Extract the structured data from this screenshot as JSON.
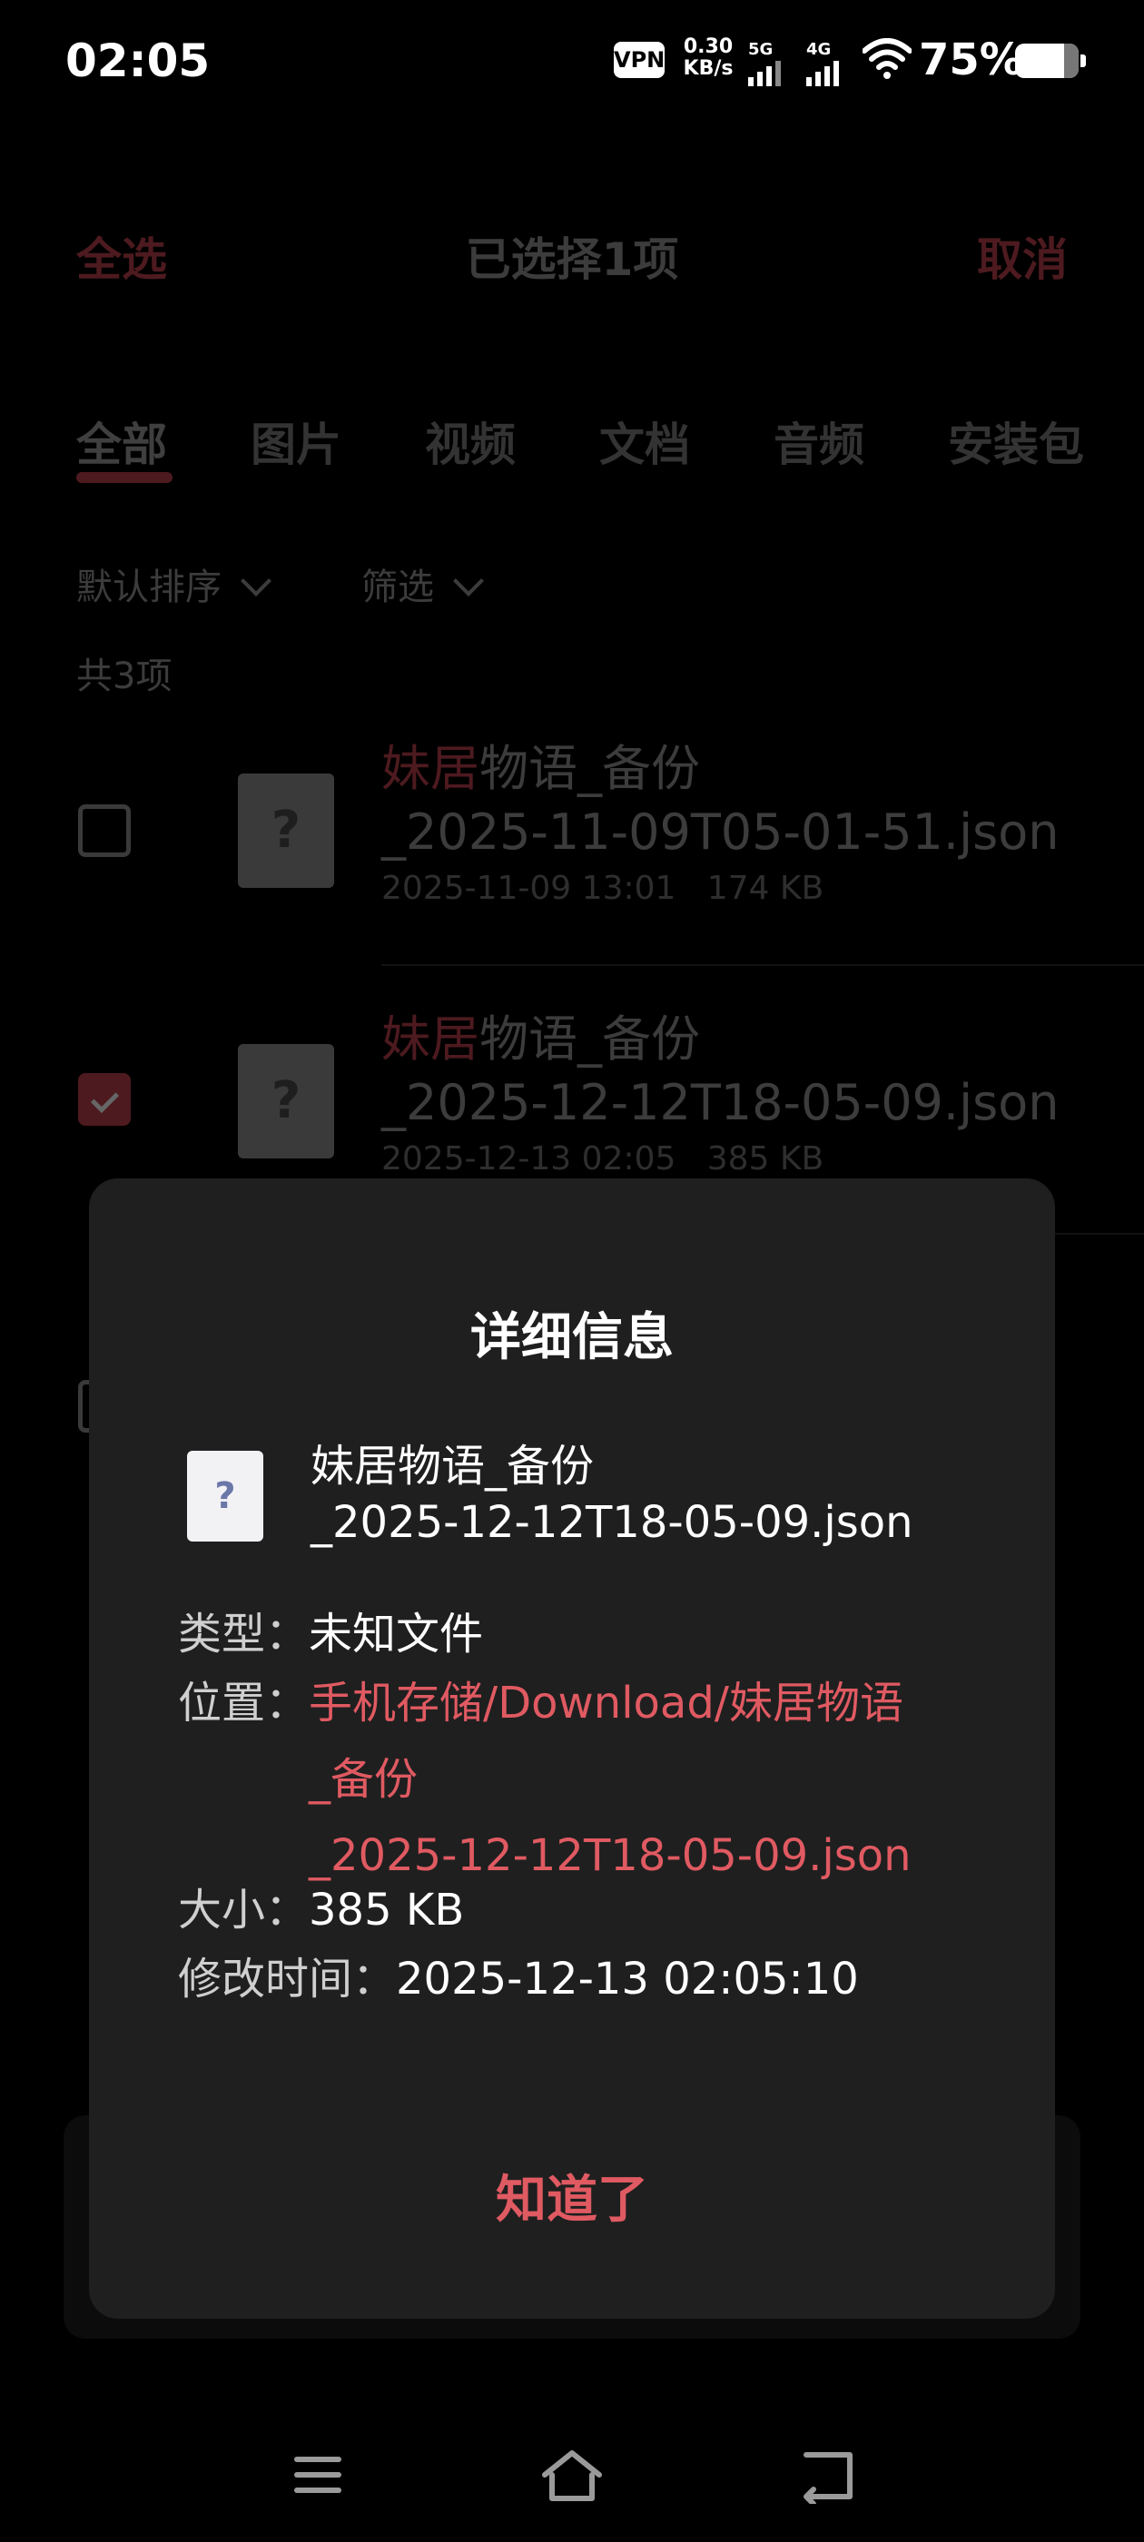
{
  "status_bar": {
    "time": "02:05",
    "vpn": "VPN",
    "speed_value": "0.30",
    "speed_unit": "KB/s",
    "net1": "5G",
    "net2": "4G",
    "battery": "75%"
  },
  "header": {
    "select_all": "全选",
    "selected_count": "已选择1项",
    "cancel": "取消"
  },
  "tabs": [
    "全部",
    "图片",
    "视频",
    "文档",
    "音频",
    "安装包"
  ],
  "filters": {
    "sort": "默认排序",
    "filter": "筛选"
  },
  "count_label": "共3项",
  "files": [
    {
      "name_highlight": "妹居",
      "name_rest": "物语_备份",
      "name_line2": "_2025-11-09T05-01-51.json",
      "date": "2025-11-09 13:01",
      "size": "174 KB",
      "checked": false
    },
    {
      "name_highlight": "妹居",
      "name_rest": "物语_备份",
      "name_line2": "_2025-12-12T18-05-09.json",
      "date": "2025-12-13 02:05",
      "size": "385 KB",
      "checked": true
    }
  ],
  "dialog": {
    "title": "详细信息",
    "icon_glyph": "?",
    "file_name_line1": "妹居物语_备份",
    "file_name_line2": "_2025-12-12T18-05-09.json",
    "type_label": "类型：",
    "type_value": "未知文件",
    "location_label": "位置：",
    "location_line1": "手机存储/Download/妹居物语",
    "location_line2": "_备份",
    "location_line3": "_2025-12-12T18-05-09.json",
    "size_label": "大小：",
    "size_value": "385 KB",
    "modified_label": "修改时间：",
    "modified_value": "2025-12-13 02:05:10",
    "ok_button": "知道了"
  },
  "colors": {
    "accent": "#e05a62",
    "dialog_bg": "#1f1f1f"
  },
  "icons": [
    "vpn-badge",
    "signal-icon",
    "wifi-icon",
    "battery-icon",
    "chevron-down-icon",
    "file-unknown-icon",
    "menu-icon",
    "home-icon",
    "back-icon"
  ]
}
